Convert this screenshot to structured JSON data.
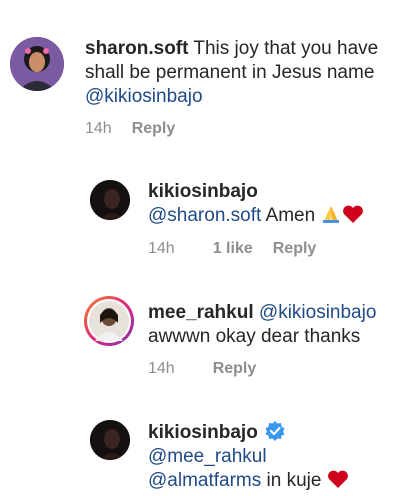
{
  "comments": [
    {
      "username": "sharon.soft",
      "text": " This joy that you have shall be permanent in Jesus name ",
      "mention": "@kikiosinbajo",
      "time": "14h",
      "reply": "Reply"
    },
    {
      "username": "kikiosinbajo",
      "mention": "@sharon.soft",
      "text": " Amen",
      "time": "14h",
      "likes": "1 like",
      "reply": "Reply"
    },
    {
      "username": "mee_rahkul",
      "mention": "@kikiosinbajo",
      "text": "awwwn okay dear thanks",
      "time": "14h",
      "reply": "Reply"
    },
    {
      "username": "kikiosinbajo",
      "mention1": "@mee_rahkul",
      "mention2": "@almatfarms",
      "text": " in kuje"
    }
  ],
  "colors": {
    "mention": "#1f4a87",
    "meta": "#8e8e8e",
    "verified": "#3897f0",
    "heart": "#d0021b"
  },
  "icons": [
    "folded-hands-icon",
    "red-heart-icon",
    "verified-badge-icon"
  ]
}
